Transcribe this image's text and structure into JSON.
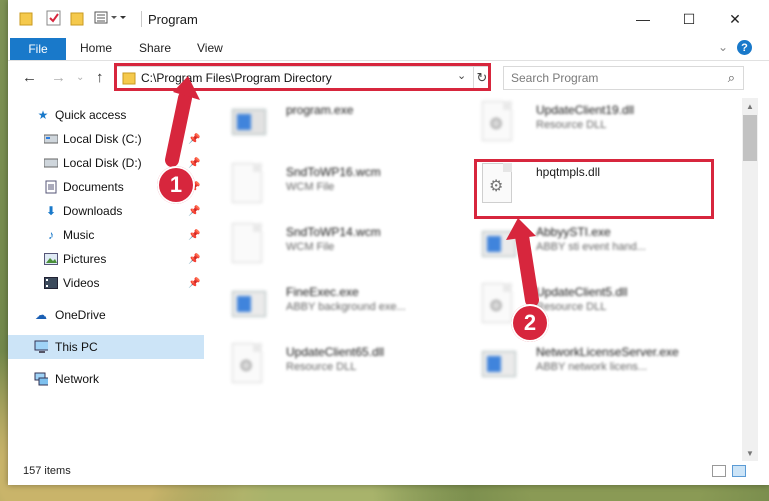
{
  "window": {
    "title": "Program",
    "minimize": "—",
    "maximize": "☐",
    "close": "✕"
  },
  "ribbon": {
    "file": "File",
    "home": "Home",
    "share": "Share",
    "view": "View",
    "help": "?"
  },
  "address": {
    "path": "C:\\Program Files\\Program Directory"
  },
  "search": {
    "placeholder": "Search Program"
  },
  "sidebar": {
    "items": [
      {
        "label": "Quick access"
      },
      {
        "label": "Local Disk (C:)"
      },
      {
        "label": "Local Disk (D:)"
      },
      {
        "label": "Documents"
      },
      {
        "label": "Downloads"
      },
      {
        "label": "Music"
      },
      {
        "label": "Pictures"
      },
      {
        "label": "Videos"
      },
      {
        "label": "OneDrive"
      },
      {
        "label": "This PC"
      },
      {
        "label": "Network"
      }
    ]
  },
  "files": [
    {
      "name": "program.exe",
      "desc": ""
    },
    {
      "name": "UpdateClient19.dll",
      "desc": "Resource DLL"
    },
    {
      "name": "SndToWP16.wcm",
      "desc": "WCM File"
    },
    {
      "name": "hpqtmpls.dll",
      "desc": ""
    },
    {
      "name": "SndToWP14.wcm",
      "desc": "WCM File"
    },
    {
      "name": "AbbyySTI.exe",
      "desc": "ABBY sti event hand..."
    },
    {
      "name": "FineExec.exe",
      "desc": "ABBY background exe..."
    },
    {
      "name": "UpdateClient5.dll",
      "desc": "Resource DLL"
    },
    {
      "name": "UpdateClient65.dll",
      "desc": "Resource DLL"
    },
    {
      "name": "NetworkLicenseServer.exe",
      "desc": "ABBY network licens..."
    }
  ],
  "status": {
    "count": "157 items"
  },
  "callouts": {
    "one": "1",
    "two": "2"
  },
  "colors": {
    "accent": "#1979ca",
    "highlight": "#d7263d",
    "selection": "#cce4f7"
  }
}
